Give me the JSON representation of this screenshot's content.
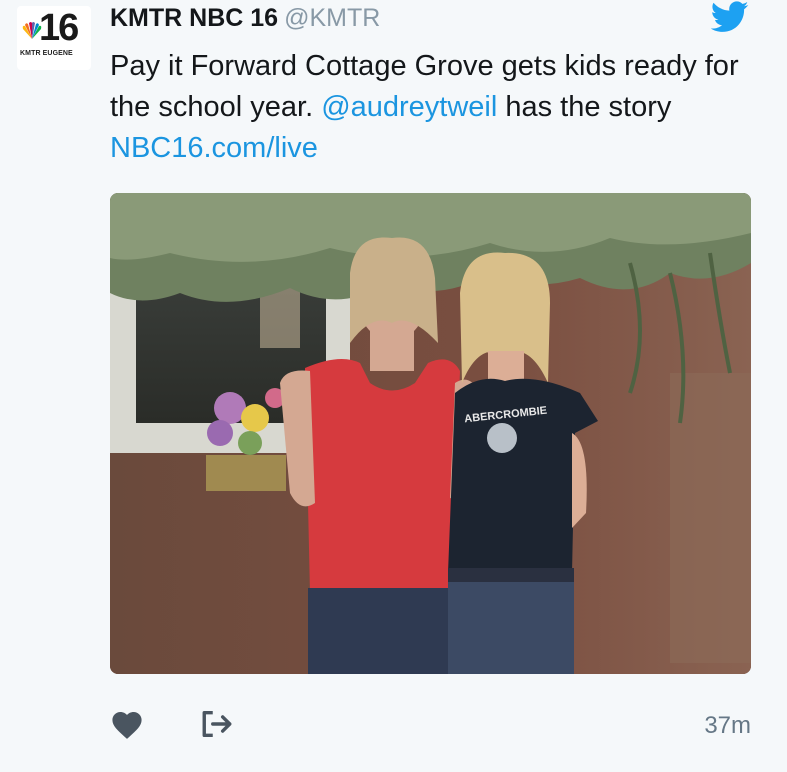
{
  "avatar": {
    "logo_number": "16",
    "logo_subtitle": "KMTR EUGENE",
    "colors": [
      "#fcb711",
      "#f37021",
      "#cc004c",
      "#6460aa",
      "#0089d0",
      "#0db14b"
    ]
  },
  "header": {
    "display_name": "KMTR NBC 16",
    "handle": "@KMTR",
    "platform_icon": "twitter-bird-icon"
  },
  "tweet": {
    "text_part1": "Pay it Forward Cottage Grove gets kids ready for the school year. ",
    "mention": "@audreytweil",
    "text_part2": " has the story ",
    "link": "NBC16.com/live"
  },
  "photo": {
    "shirt_text": "ABERCROMBIE"
  },
  "actions": {
    "like_icon": "heart-icon",
    "share_icon": "share-arrow-icon",
    "timestamp": "37m"
  },
  "colors": {
    "link": "#1b95e0",
    "twitter_blue": "#1da1f2",
    "secondary_text": "#657786",
    "action_icon": "#4a5560"
  }
}
